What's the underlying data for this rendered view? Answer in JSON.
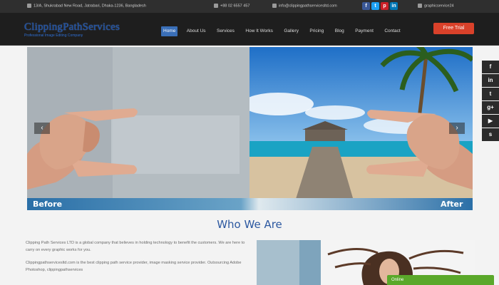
{
  "topbar": {
    "address": "13/A, Shukrabad New Road, Jatrabari, Dhaka-1236, Bangladesh",
    "phone": "+88 02 6557 457",
    "email": "info@clippingpathservicesltd.com",
    "skype": "graphicservice24"
  },
  "header": {
    "logo_name": "ClippingPathServices",
    "logo_tagline": "Professional Image Editing Company",
    "nav": [
      "Home",
      "About Us",
      "Services",
      "How It Works",
      "Gallery",
      "Pricing",
      "Blog",
      "Payment",
      "Contact"
    ],
    "cta": "Free Trial"
  },
  "slider": {
    "before_label": "Before",
    "after_label": "After",
    "prev_icon": "chevron-left-icon",
    "next_icon": "chevron-right-icon"
  },
  "social_rail": [
    "facebook-icon",
    "linkedin-icon",
    "twitter-icon",
    "google-plus-icon",
    "youtube-icon",
    "skype-icon"
  ],
  "social_top": [
    "facebook-icon",
    "twitter-icon",
    "pinterest-icon",
    "linkedin-icon"
  ],
  "about": {
    "title": "Who We Are",
    "paragraph_1": "Clipping Path Services LTD is a global company that believes in holding technology to benefit the customers. We are here to carry on every graphic works for you.",
    "paragraph_2": "Clippingpathservicesltd.com is the best clipping path service provider, image masking service provider. Outsourcing Adobe Photoshop, clippingpathservices"
  },
  "chat": {
    "label": "Online"
  },
  "colors": {
    "accent": "#3a6fb8",
    "cta": "#d9412a",
    "title": "#2c58a0",
    "chat": "#5aa82a"
  }
}
